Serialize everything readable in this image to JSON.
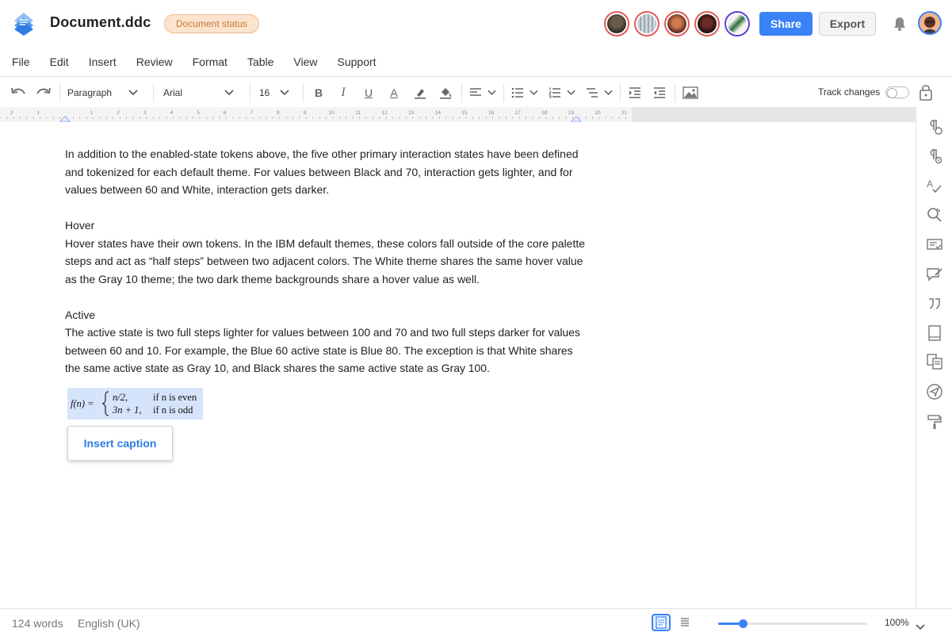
{
  "header": {
    "title": "Document.ddc",
    "status": "Document status",
    "share_label": "Share",
    "export_label": "Export",
    "accent_color": "#3b82f6"
  },
  "menu": [
    "File",
    "Edit",
    "Insert",
    "Review",
    "Format",
    "Table",
    "View",
    "Support"
  ],
  "toolbar": {
    "style_value": "Paragraph",
    "font_value": "Arial",
    "size_value": "16",
    "track_changes_label": "Track changes",
    "track_changes_on": false
  },
  "ruler": {
    "numbers": [
      "2",
      "1",
      "1",
      "2",
      "3",
      "4",
      "5",
      "6",
      "7",
      "8",
      "9",
      "10",
      "11",
      "12",
      "13",
      "14",
      "15",
      "16",
      "17",
      "18",
      "19",
      "20",
      "21"
    ]
  },
  "document": {
    "intro": "In addition to the enabled-state tokens above, the five other primary interaction states have been defined and tokenized for each default theme. For values between Black and 70, interaction gets lighter, and for values between 60 and White, interaction gets darker.",
    "hover_heading": "Hover",
    "hover_text": "Hover states have their own tokens. In the IBM default themes, these colors fall outside of the core palette steps and act as “half steps” between two adjacent colors. The White theme shares the same hover value as the Gray 10 theme; the two dark theme backgrounds share a hover value as well.",
    "active_heading": "Active",
    "active_text": "The active state is two full steps lighter for values between 100 and 70 and two full steps darker for values between 60 and 10. For example, the Blue 60 active state is Blue 80. The exception is that White shares the same active state as Gray 10, and Black shares the same active state as Gray 100.",
    "formula": {
      "lhs": "f(n) =",
      "case1_expr": "n/2,",
      "case1_cond": "if n is even",
      "case2_expr": "3n + 1,",
      "case2_cond": "if n is odd"
    },
    "caption_button": "Insert caption"
  },
  "statusbar": {
    "word_count": "124 words",
    "language": "English (UK)",
    "zoom": "100%",
    "zoom_fraction": 0.15
  },
  "icons": {
    "undo": "undo-icon",
    "redo": "redo-icon",
    "bold": "bold-icon",
    "italic": "italic-icon",
    "underline": "underline-icon",
    "font_color": "font-color-icon",
    "highlight": "highlight-icon",
    "fill": "fill-icon",
    "align": "align-left-icon",
    "bullets": "bullet-list-icon",
    "numbered": "numbered-list-icon",
    "multilevel": "multilevel-list-icon",
    "indent": "indent-icon",
    "outdent": "outdent-icon",
    "image": "image-icon",
    "lock": "lock-icon"
  }
}
